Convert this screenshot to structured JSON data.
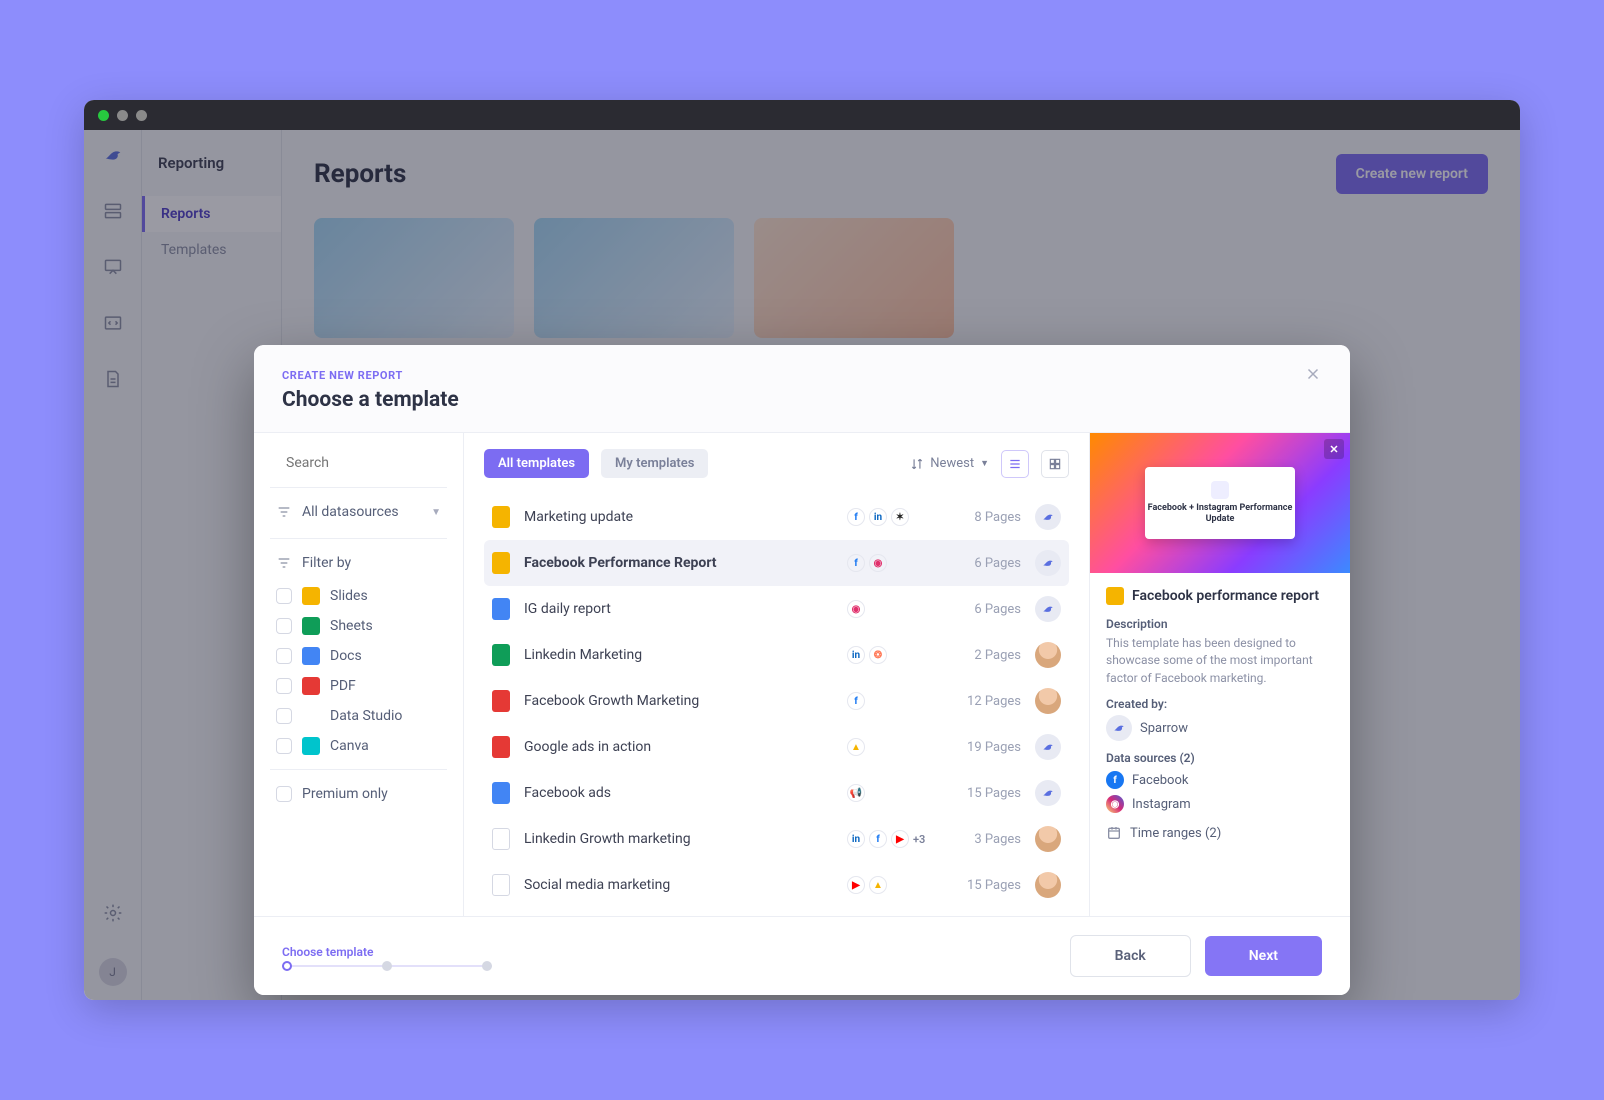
{
  "subnav": {
    "title": "Reporting",
    "items": [
      "Reports",
      "Templates"
    ],
    "active_index": 0
  },
  "main": {
    "title": "Reports",
    "create_button": "Create new report"
  },
  "modal": {
    "kicker": "CREATE NEW REPORT",
    "title": "Choose a template",
    "search_placeholder": "Search",
    "all_datasources": "All datasources",
    "filter_by": "Filter by",
    "filter_options": [
      {
        "label": "Slides",
        "kind": "slides"
      },
      {
        "label": "Sheets",
        "kind": "sheets"
      },
      {
        "label": "Docs",
        "kind": "docs"
      },
      {
        "label": "PDF",
        "kind": "pdf"
      },
      {
        "label": "Data Studio",
        "kind": "ds"
      },
      {
        "label": "Canva",
        "kind": "canva"
      }
    ],
    "premium_only": "Premium only",
    "tabs": {
      "all": "All templates",
      "my": "My templates"
    },
    "sort_label": "Newest",
    "templates": [
      {
        "name": "Marketing update",
        "doc": "slides",
        "sources": [
          "fb",
          "in",
          "mc"
        ],
        "pages": "8 Pages",
        "owner": "bird"
      },
      {
        "name": "Facebook Performance Report",
        "doc": "slides",
        "sources": [
          "fb",
          "ig"
        ],
        "pages": "6 Pages",
        "owner": "bird",
        "selected": true
      },
      {
        "name": "IG daily report",
        "doc": "docs",
        "sources": [
          "ig"
        ],
        "pages": "6 Pages",
        "owner": "bird"
      },
      {
        "name": "Linkedin Marketing",
        "doc": "sheets",
        "sources": [
          "in",
          "hs"
        ],
        "pages": "2 Pages",
        "owner": "face"
      },
      {
        "name": "Facebook Growth Marketing",
        "doc": "pdf",
        "sources": [
          "fb"
        ],
        "pages": "12 Pages",
        "owner": "face"
      },
      {
        "name": "Google ads in action",
        "doc": "pdf",
        "sources": [
          "ga"
        ],
        "pages": "19 Pages",
        "owner": "bird"
      },
      {
        "name": "Facebook ads",
        "doc": "docs",
        "sources": [
          "ann"
        ],
        "pages": "15 Pages",
        "owner": "bird"
      },
      {
        "name": "Linkedin Growth marketing",
        "doc": "ds",
        "sources": [
          "in",
          "fb",
          "yt"
        ],
        "extra": "+3",
        "pages": "3 Pages",
        "owner": "face"
      },
      {
        "name": "Social media marketing",
        "doc": "ds",
        "sources": [
          "yt",
          "ga"
        ],
        "pages": "15 Pages",
        "owner": "face"
      }
    ],
    "preview": {
      "hero_title": "Facebook + Instagram\nPerformance Update",
      "title": "Facebook performance report",
      "desc_label": "Description",
      "desc_text": "This template has been designed to showcase some of the most important factor of Facebook marketing.",
      "created_by_label": "Created by:",
      "creator": "Sparrow",
      "data_sources_label": "Data sources (2)",
      "data_sources": [
        {
          "name": "Facebook",
          "kind": "fb"
        },
        {
          "name": "Instagram",
          "kind": "ig"
        }
      ],
      "time_ranges_label": "Time ranges (2)"
    },
    "footer": {
      "step_label": "Choose template",
      "back": "Back",
      "next": "Next"
    }
  },
  "avatar_initial": "J"
}
